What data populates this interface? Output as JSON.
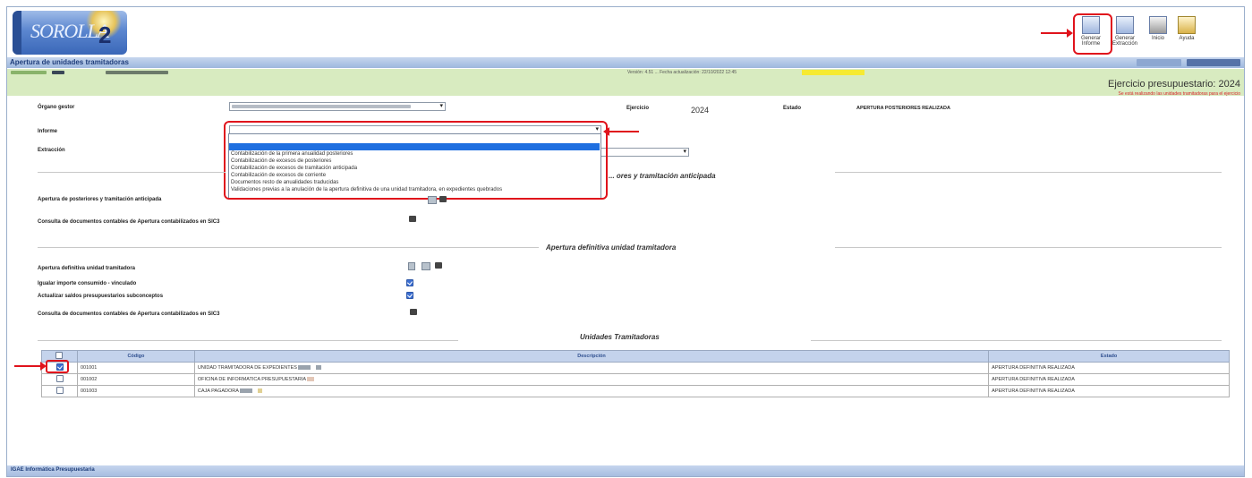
{
  "app": {
    "logo_text": "SOROLLA",
    "logo_version": "2",
    "page_title": "Apertura de unidades tramitadoras",
    "version_line": "Versión: 4.51 ... Fecha actualización: 22/10/2022 12:45",
    "ejercicio_label": "Ejercicio presupuestario: 2024",
    "aviso": "Se está realizando las unidades tramitadoras para el ejercicio"
  },
  "toolbar": {
    "buttons": [
      {
        "label": "Generar Informe",
        "icon": "report-icon"
      },
      {
        "label": "Generar Extracción",
        "icon": "extract-icon"
      },
      {
        "label": "Inicio",
        "icon": "home-icon"
      },
      {
        "label": "Ayuda",
        "icon": "help-icon"
      }
    ]
  },
  "form": {
    "organo_label": "Órgano gestor",
    "ejercicio_label": "Ejercicio",
    "ejercicio_value": "2024",
    "estado_label": "Estado",
    "estado_value": "APERTURA POSTERIORES REALIZADA",
    "informe_label": "Informe",
    "extraccion_label": "Extracción"
  },
  "dropdown": {
    "options": [
      "",
      "Contabilización de la primera anualidad posteriores",
      "Contabilización de excesos de posteriores",
      "Contabilización de excesos de tramitación anticipada",
      "Contabilización de excesos de corriente",
      "Documentos resto de anualidades traducidas",
      "Validaciones previas a la anulación de la apertura definitiva de una unidad tramitadora, en expedientes quebrados"
    ]
  },
  "sections": {
    "posteriores_title": "... ores y tramitación anticipada",
    "apertura_post_label": "Apertura de posteriores y tramitación anticipada",
    "consulta_docs_label": "Consulta de documentos contables de Apertura contabilizados en SIC3",
    "definitiva_title": "Apertura definitiva unidad tramitadora",
    "apertura_def_label": "Apertura definitiva unidad tramitadora",
    "igualar_label": "Igualar importe consumido - vinculado",
    "actualizar_label": "Actualizar saldos presupuestarios subconceptos",
    "consulta_docs2_label": "Consulta de documentos contables de Apertura contabilizados en SIC3",
    "unidades_title": "Unidades Tramitadoras"
  },
  "table": {
    "headers": [
      "",
      "Código",
      "Descripción",
      "Estado"
    ],
    "rows": [
      {
        "checked": true,
        "codigo": "001001",
        "descripcion": "UNIDAD TRAMITADORA DE EXPEDIENTES",
        "estado": "APERTURA DEFINITIVA REALIZADA"
      },
      {
        "checked": false,
        "codigo": "001002",
        "descripcion": "OFICINA DE INFORMATICA PRESUPUESTARIA",
        "estado": "APERTURA DEFINITIVA REALIZADA"
      },
      {
        "checked": false,
        "codigo": "001003",
        "descripcion": "CAJA PAGADORA",
        "estado": "APERTURA DEFINITIVA REALIZADA"
      }
    ]
  },
  "footer": {
    "text": "IGAE Informática Presupuestaria"
  },
  "colors": {
    "accent_red": "#e0131c",
    "header_blue": "#c4d3ec",
    "green_bar": "#d8ebc0"
  }
}
